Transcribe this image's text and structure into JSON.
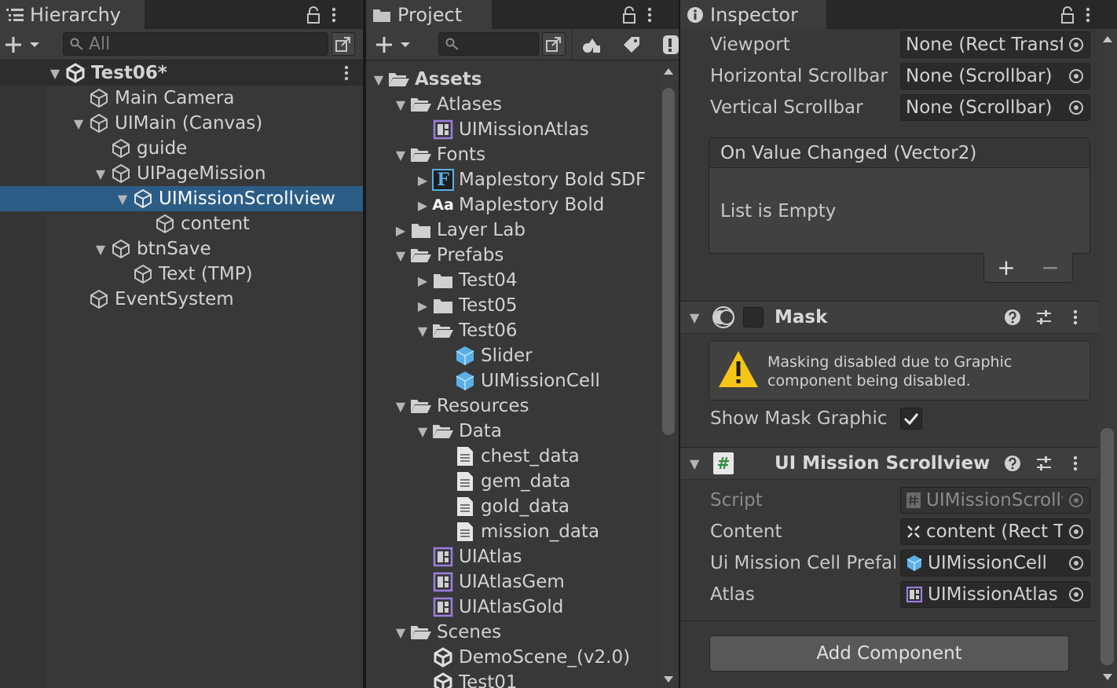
{
  "colors": {
    "selection": "#2c5d87",
    "panel": "#383838",
    "accent_purple": "#9b7ee0",
    "accent_blue": "#5ab0e6"
  },
  "hierarchy": {
    "tab": "Hierarchy",
    "search_placeholder": "All",
    "scene": "Test06*",
    "items": [
      {
        "label": "Main Camera",
        "icon": "gameobject-icon"
      },
      {
        "label": "UIMain (Canvas)",
        "icon": "gameobject-icon"
      },
      {
        "label": "guide",
        "icon": "gameobject-icon"
      },
      {
        "label": "UIPageMission",
        "icon": "gameobject-icon"
      },
      {
        "label": "UIMissionScrollview",
        "icon": "gameobject-icon"
      },
      {
        "label": "content",
        "icon": "gameobject-icon"
      },
      {
        "label": "btnSave",
        "icon": "gameobject-icon"
      },
      {
        "label": "Text (TMP)",
        "icon": "gameobject-icon"
      },
      {
        "label": "EventSystem",
        "icon": "gameobject-icon"
      }
    ]
  },
  "project": {
    "tab": "Project",
    "search_value": "",
    "items": [
      {
        "label": "Assets"
      },
      {
        "label": "Atlases"
      },
      {
        "label": "UIMissionAtlas"
      },
      {
        "label": "Fonts"
      },
      {
        "label": "Maplestory Bold SDF"
      },
      {
        "label": "Maplestory Bold"
      },
      {
        "label": "Layer Lab"
      },
      {
        "label": "Prefabs"
      },
      {
        "label": "Test04"
      },
      {
        "label": "Test05"
      },
      {
        "label": "Test06"
      },
      {
        "label": "Slider"
      },
      {
        "label": "UIMissionCell"
      },
      {
        "label": "Resources"
      },
      {
        "label": "Data"
      },
      {
        "label": "chest_data"
      },
      {
        "label": "gem_data"
      },
      {
        "label": "gold_data"
      },
      {
        "label": "mission_data"
      },
      {
        "label": "UIAtlas"
      },
      {
        "label": "UIAtlasGem"
      },
      {
        "label": "UIAtlasGold"
      },
      {
        "label": "Scenes"
      },
      {
        "label": "DemoScene_(v2.0)"
      },
      {
        "label": "Test01"
      }
    ],
    "font_glyph_tmp": "F",
    "font_glyph_aa": "Aa"
  },
  "inspector": {
    "tab": "Inspector",
    "scroll_props": [
      {
        "label": "Viewport",
        "value": "None (Rect Transform)"
      },
      {
        "label": "Horizontal Scrollbar",
        "value": "None (Scrollbar)"
      },
      {
        "label": "Vertical Scrollbar",
        "value": "None (Scrollbar)"
      }
    ],
    "event": {
      "title": "On Value Changed (Vector2)",
      "empty": "List is Empty",
      "add": "+",
      "remove": "−"
    },
    "mask": {
      "title": "Mask",
      "warning": "Masking disabled due to Graphic component being disabled.",
      "warning_line1": "Masking disabled due to Graphic",
      "warning_line2": "component being disabled.",
      "show_label": "Show Mask Graphic",
      "show_checked": true
    },
    "script_comp": {
      "title": "UI Mission Scrollview (Script)",
      "icon_glyph": "#",
      "props": [
        {
          "label": "Script",
          "value": "UIMissionScrollview"
        },
        {
          "label": "Content",
          "value": "content (Rect Transform)"
        },
        {
          "label": "Ui Mission Cell Prefab",
          "value": "UIMissionCell"
        },
        {
          "label": "Atlas",
          "value": "UIMissionAtlas"
        }
      ]
    },
    "add_component": "Add Component"
  }
}
